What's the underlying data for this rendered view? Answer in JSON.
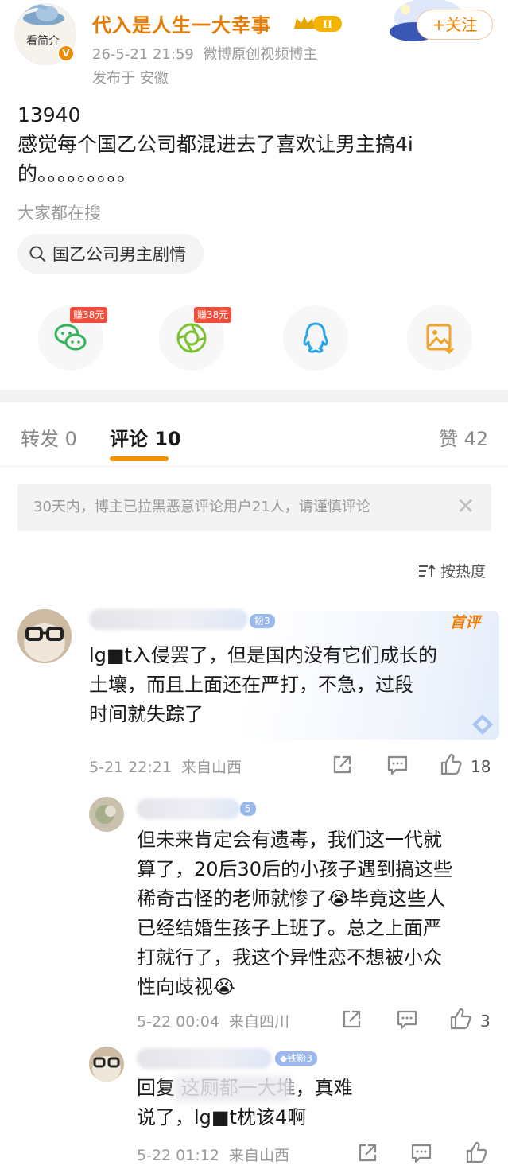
{
  "post": {
    "avatar_label": "看简介",
    "author": "代入是人生一大幸事",
    "vip_level": "II",
    "meta_time": "26-5-21 21:59",
    "meta_role": "微博原创视频博主",
    "location": "发布于 安徽",
    "follow_label": "+关注",
    "text_line1": "13940",
    "text_line2": "感觉每个国乙公司都混进去了喜欢让男主搞4i",
    "text_line3": "的。。。。。。。。。",
    "search_hint": "大家都在搜",
    "search_chip": "国乙公司男主剧情"
  },
  "share": {
    "earn_badge": "赚38元",
    "items": [
      "wechat-icon",
      "moments-icon",
      "qq-icon",
      "save-image-icon"
    ]
  },
  "tabs": {
    "repost": "转发 0",
    "comments": "评论 10",
    "likes": "赞 42"
  },
  "notice": {
    "text": "30天内，博主已拉黑恶意评论用户21人，请谨慎评论",
    "close": "✕"
  },
  "sort": {
    "label": "按热度"
  },
  "comments": [
    {
      "fan_badge": "粉3",
      "first_badge": "首评",
      "lines": [
        "lg■t入侵罢了，但是国内没有它们成长的",
        "土壤，而且上面还在严打，不急，过段",
        "时间就失踪了"
      ],
      "time": "5-21 22:21",
      "location": "来自山西",
      "likes": "18"
    },
    {
      "fan_badge": "5",
      "lines": [
        "但未来肯定会有遗毒，我们这一代就",
        "算了，20后30后的小孩子遇到搞这些",
        "稀奇古怪的老师就惨了😭毕竟这些人",
        "已经结婚生孩子上班了。总之上面严",
        "打就行了，我这个异性恋不想被小众",
        "性向歧视😭"
      ],
      "time": "5-22 00:04",
      "location": "来自四川",
      "likes": "3"
    },
    {
      "fan_badge": "◆铁粉3",
      "lines": [
        "回复                         这厕都一大堆，真难",
        "说了，lg■t枕该4啊"
      ],
      "time": "5-22 01:12",
      "location": "来自山西",
      "likes": ""
    }
  ],
  "colors": {
    "accent": "#f29100",
    "author": "#e77c00",
    "meta": "#9a9a9a"
  }
}
